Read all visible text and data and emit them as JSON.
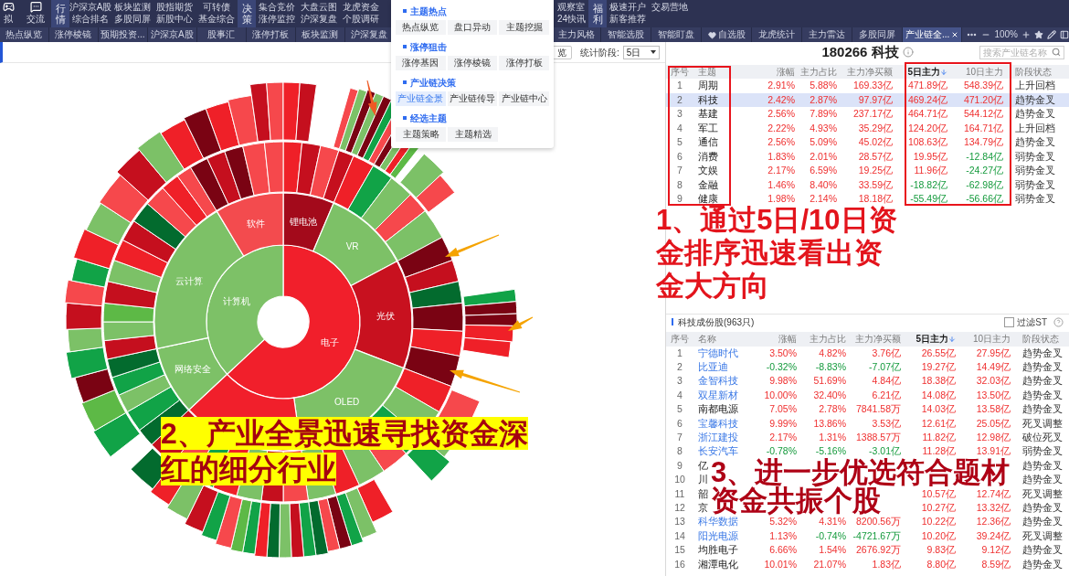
{
  "top_bar": {
    "shortcuts": [
      {
        "label": "拟"
      },
      {
        "label": "交流"
      }
    ],
    "groups": [
      {
        "title": "行情",
        "columns": [
          [
            "沪深京A股",
            "综合排名"
          ],
          [
            "板块监测",
            "多股同屏"
          ],
          [
            "股指期货",
            "新股中心"
          ],
          [
            "可转债",
            "基金综合"
          ]
        ]
      },
      {
        "title": "决策",
        "columns": [
          [
            "集合竞价",
            "涨停监控"
          ],
          [
            "大盘云图",
            "沪深复盘"
          ],
          [
            "龙虎资金",
            "个股调研"
          ],
          [
            "观察室",
            "24快讯"
          ]
        ]
      },
      {
        "title": "福利",
        "columns": [
          [
            "极速开户",
            "新客推荐"
          ],
          [
            "交易营地"
          ]
        ]
      }
    ]
  },
  "tab_bar": {
    "tabs": [
      {
        "label": "热点纵览",
        "selected": false,
        "kind": "text"
      },
      {
        "label": "涨停棱镜",
        "selected": false,
        "kind": "text"
      },
      {
        "label": "预期投资...",
        "selected": false,
        "kind": "text"
      },
      {
        "label": "沪深京A股",
        "selected": false,
        "kind": "text"
      },
      {
        "label": "股事汇",
        "selected": false,
        "kind": "text"
      },
      {
        "label": "涨停打板",
        "selected": false,
        "kind": "text"
      },
      {
        "label": "板块监测",
        "selected": false,
        "kind": "text"
      },
      {
        "label": "沪深复盘",
        "selected": false,
        "kind": "text"
      },
      {
        "label": "主力风格",
        "selected": false,
        "kind": "text"
      },
      {
        "label": "智能选股",
        "selected": false,
        "kind": "text"
      },
      {
        "label": "智能盯盘",
        "selected": false,
        "kind": "text"
      },
      {
        "label": "自选股",
        "selected": false,
        "kind": "icon_text"
      },
      {
        "label": "龙虎统计",
        "selected": false,
        "kind": "text"
      },
      {
        "label": "主力雷达",
        "selected": false,
        "kind": "text"
      },
      {
        "label": "多股同屏",
        "selected": false,
        "kind": "text"
      },
      {
        "label": "产业链全...",
        "selected": true,
        "kind": "text"
      }
    ],
    "zoom_level": "100%"
  },
  "dropdown_menu": {
    "sections": [
      {
        "title": "主题热点",
        "items": [
          {
            "label": "热点纵览",
            "selected": false
          },
          {
            "label": "盘口异动",
            "selected": false
          },
          {
            "label": "主题挖掘",
            "selected": false
          }
        ]
      },
      {
        "title": "涨停狙击",
        "items": [
          {
            "label": "涨停基因",
            "selected": false
          },
          {
            "label": "涨停棱镜",
            "selected": false
          },
          {
            "label": "涨停打板",
            "selected": false
          }
        ]
      },
      {
        "title": "产业链决策",
        "items": [
          {
            "label": "产业链全景",
            "selected": true
          },
          {
            "label": "产业链传导",
            "selected": false
          },
          {
            "label": "产业链中心",
            "selected": false
          }
        ]
      },
      {
        "title": "经选主题",
        "items": [
          {
            "label": "主题策略",
            "selected": false
          },
          {
            "label": "主题精选",
            "selected": false
          }
        ]
      }
    ]
  },
  "toolbar": {
    "overview_button": "览",
    "period_label": "统计阶段:",
    "period_value": "5日"
  },
  "industry_chart": {
    "inner_ring": [
      {
        "label": "电子",
        "color": "#f11f2b"
      },
      {
        "label": "计算机",
        "color": "#7dc167"
      }
    ],
    "middle_ring": [
      {
        "label": "锂电池",
        "color": "#a30a1b"
      },
      {
        "label": "VR",
        "color": "#7dc167"
      },
      {
        "label": "光伏",
        "color": "#c8111f"
      },
      {
        "label": "OLED",
        "color": "#7dc167"
      },
      {
        "color": "#f11f2b"
      },
      {
        "label": "网络安全",
        "color": "#7dc167"
      },
      {
        "label": "云计算",
        "color": "#7dc167"
      },
      {
        "label": "软件",
        "color": "#f34b4e"
      }
    ]
  },
  "theme_panel": {
    "title": "180266 科技",
    "search_placeholder": "搜索产业链名称",
    "columns": [
      {
        "label": "序号",
        "sorted": false
      },
      {
        "label": "主题",
        "sorted": false
      },
      {
        "label": "涨幅",
        "sorted": false
      },
      {
        "label": "主力占比",
        "sorted": false
      },
      {
        "label": "主力净买额",
        "sorted": false
      },
      {
        "label": "5日主力",
        "sorted": true
      },
      {
        "label": "10日主力",
        "sorted": false
      },
      {
        "label": "阶段状态",
        "sorted": false
      }
    ],
    "rows": [
      {
        "no": "1",
        "name": "周期",
        "selected": false,
        "change": {
          "text": "2.91%",
          "negative": false
        },
        "main_ratio": {
          "text": "5.88%",
          "negative": false
        },
        "net_buy": {
          "text": "169.33亿",
          "negative": false
        },
        "main_5d": {
          "text": "471.89亿",
          "negative": false
        },
        "main_10d": {
          "text": "548.39亿",
          "negative": false
        },
        "stage": "上升回档"
      },
      {
        "no": "2",
        "name": "科技",
        "selected": true,
        "change": {
          "text": "2.42%",
          "negative": false
        },
        "main_ratio": {
          "text": "2.87%",
          "negative": false
        },
        "net_buy": {
          "text": "97.97亿",
          "negative": false
        },
        "main_5d": {
          "text": "469.24亿",
          "negative": false
        },
        "main_10d": {
          "text": "471.20亿",
          "negative": false
        },
        "stage": "趋势金叉"
      },
      {
        "no": "3",
        "name": "基建",
        "selected": false,
        "change": {
          "text": "2.56%",
          "negative": false
        },
        "main_ratio": {
          "text": "7.89%",
          "negative": false
        },
        "net_buy": {
          "text": "237.17亿",
          "negative": false
        },
        "main_5d": {
          "text": "464.71亿",
          "negative": false
        },
        "main_10d": {
          "text": "544.12亿",
          "negative": false
        },
        "stage": "趋势金叉"
      },
      {
        "no": "4",
        "name": "军工",
        "selected": false,
        "change": {
          "text": "2.22%",
          "negative": false
        },
        "main_ratio": {
          "text": "4.93%",
          "negative": false
        },
        "net_buy": {
          "text": "35.29亿",
          "negative": false
        },
        "main_5d": {
          "text": "124.20亿",
          "negative": false
        },
        "main_10d": {
          "text": "164.71亿",
          "negative": false
        },
        "stage": "上升回档"
      },
      {
        "no": "5",
        "name": "通信",
        "selected": false,
        "change": {
          "text": "2.56%",
          "negative": false
        },
        "main_ratio": {
          "text": "5.09%",
          "negative": false
        },
        "net_buy": {
          "text": "45.02亿",
          "negative": false
        },
        "main_5d": {
          "text": "108.63亿",
          "negative": false
        },
        "main_10d": {
          "text": "134.79亿",
          "negative": false
        },
        "stage": "趋势金叉"
      },
      {
        "no": "6",
        "name": "消费",
        "selected": false,
        "change": {
          "text": "1.83%",
          "negative": false
        },
        "main_ratio": {
          "text": "2.01%",
          "negative": false
        },
        "net_buy": {
          "text": "28.57亿",
          "negative": false
        },
        "main_5d": {
          "text": "19.95亿",
          "negative": false
        },
        "main_10d": {
          "text": "-12.84亿",
          "negative": true
        },
        "stage": "弱势金叉"
      },
      {
        "no": "7",
        "name": "文娱",
        "selected": false,
        "change": {
          "text": "2.17%",
          "negative": false
        },
        "main_ratio": {
          "text": "6.59%",
          "negative": false
        },
        "net_buy": {
          "text": "19.25亿",
          "negative": false
        },
        "main_5d": {
          "text": "11.96亿",
          "negative": false
        },
        "main_10d": {
          "text": "-24.27亿",
          "negative": true
        },
        "stage": "弱势金叉"
      },
      {
        "no": "8",
        "name": "金融",
        "selected": false,
        "change": {
          "text": "1.46%",
          "negative": false
        },
        "main_ratio": {
          "text": "8.40%",
          "negative": false
        },
        "net_buy": {
          "text": "33.59亿",
          "negative": false
        },
        "main_5d": {
          "text": "-18.82亿",
          "negative": true
        },
        "main_10d": {
          "text": "-62.98亿",
          "negative": true
        },
        "stage": "弱势金叉"
      },
      {
        "no": "9",
        "name": "健康",
        "selected": false,
        "change": {
          "text": "1.98%",
          "negative": false
        },
        "main_ratio": {
          "text": "2.14%",
          "negative": false
        },
        "net_buy": {
          "text": "18.18亿",
          "negative": false
        },
        "main_5d": {
          "text": "-55.49亿",
          "negative": true
        },
        "main_10d": {
          "text": "-56.66亿",
          "negative": true
        },
        "stage": "弱势金叉"
      }
    ]
  },
  "stock_panel": {
    "title": "科技成份股(963只)",
    "filter": {
      "label": "过滤ST",
      "checked": false
    },
    "columns": [
      {
        "label": "序号",
        "sorted": false
      },
      {
        "label": "名称",
        "sorted": false
      },
      {
        "label": "涨幅",
        "sorted": false
      },
      {
        "label": "主力占比",
        "sorted": false
      },
      {
        "label": "主力净买额",
        "sorted": false
      },
      {
        "label": "5日主力",
        "sorted": true
      },
      {
        "label": "10日主力",
        "sorted": false
      },
      {
        "label": "阶段状态",
        "sorted": false
      }
    ],
    "rows": [
      {
        "no": "1",
        "name": "宁德时代",
        "marked": true,
        "change": {
          "text": "3.50%",
          "negative": false
        },
        "main_ratio": {
          "text": "4.82%",
          "negative": false
        },
        "net_buy": {
          "text": "3.76亿",
          "negative": false
        },
        "main_5d": {
          "text": "26.55亿",
          "negative": false
        },
        "main_10d": {
          "text": "27.95亿",
          "negative": false
        },
        "stage": "趋势金叉"
      },
      {
        "no": "2",
        "name": "比亚迪",
        "marked": true,
        "change": {
          "text": "-0.32%",
          "negative": true
        },
        "main_ratio": {
          "text": "-8.83%",
          "negative": true
        },
        "net_buy": {
          "text": "-7.07亿",
          "negative": true
        },
        "main_5d": {
          "text": "19.27亿",
          "negative": false
        },
        "main_10d": {
          "text": "14.49亿",
          "negative": false
        },
        "stage": "趋势金叉"
      },
      {
        "no": "3",
        "name": "金智科技",
        "marked": true,
        "change": {
          "text": "9.98%",
          "negative": false
        },
        "main_ratio": {
          "text": "51.69%",
          "negative": false
        },
        "net_buy": {
          "text": "4.84亿",
          "negative": false
        },
        "main_5d": {
          "text": "18.38亿",
          "negative": false
        },
        "main_10d": {
          "text": "32.03亿",
          "negative": false
        },
        "stage": "趋势金叉"
      },
      {
        "no": "4",
        "name": "双星新材",
        "marked": true,
        "change": {
          "text": "10.00%",
          "negative": false
        },
        "main_ratio": {
          "text": "32.40%",
          "negative": false
        },
        "net_buy": {
          "text": "6.21亿",
          "negative": false
        },
        "main_5d": {
          "text": "14.08亿",
          "negative": false
        },
        "main_10d": {
          "text": "13.50亿",
          "negative": false
        },
        "stage": "趋势金叉"
      },
      {
        "no": "5",
        "name": "南都电源",
        "marked": false,
        "change": {
          "text": "7.05%",
          "negative": false
        },
        "main_ratio": {
          "text": "2.78%",
          "negative": false
        },
        "net_buy": {
          "text": "7841.58万",
          "negative": false
        },
        "main_5d": {
          "text": "14.03亿",
          "negative": false
        },
        "main_10d": {
          "text": "13.58亿",
          "negative": false
        },
        "stage": "趋势金叉"
      },
      {
        "no": "6",
        "name": "宝馨科技",
        "marked": true,
        "change": {
          "text": "9.99%",
          "negative": false
        },
        "main_ratio": {
          "text": "13.86%",
          "negative": false
        },
        "net_buy": {
          "text": "3.53亿",
          "negative": false
        },
        "main_5d": {
          "text": "12.61亿",
          "negative": false
        },
        "main_10d": {
          "text": "25.05亿",
          "negative": false
        },
        "stage": "死叉调整"
      },
      {
        "no": "7",
        "name": "浙江建投",
        "marked": true,
        "change": {
          "text": "2.17%",
          "negative": false
        },
        "main_ratio": {
          "text": "1.31%",
          "negative": false
        },
        "net_buy": {
          "text": "1388.57万",
          "negative": false
        },
        "main_5d": {
          "text": "11.82亿",
          "negative": false
        },
        "main_10d": {
          "text": "12.98亿",
          "negative": false
        },
        "stage": "破位死叉"
      },
      {
        "no": "8",
        "name": "长安汽车",
        "marked": true,
        "change": {
          "text": "-0.78%",
          "negative": true
        },
        "main_ratio": {
          "text": "-5.16%",
          "negative": true
        },
        "net_buy": {
          "text": "-3.01亿",
          "negative": true
        },
        "main_5d": {
          "text": "11.28亿",
          "negative": false
        },
        "main_10d": {
          "text": "13.91亿",
          "negative": false
        },
        "stage": "弱势金叉"
      },
      {
        "no": "9",
        "name": "亿",
        "marked": false,
        "stage": "趋势金叉"
      },
      {
        "no": "10",
        "name": "川",
        "marked": false,
        "stage": "趋势金叉"
      },
      {
        "no": "11",
        "name": "韶",
        "marked": false,
        "main_5d": {
          "text": "10.57亿",
          "negative": false
        },
        "main_10d": {
          "text": "12.74亿",
          "negative": false
        },
        "stage": "死叉调整"
      },
      {
        "no": "12",
        "name": "京",
        "marked": false,
        "main_5d": {
          "text": "10.27亿",
          "negative": false
        },
        "main_10d": {
          "text": "13.32亿",
          "negative": false
        },
        "stage": "趋势金叉"
      },
      {
        "no": "13",
        "name": "科华数据",
        "marked": true,
        "change": {
          "text": "5.32%",
          "negative": false
        },
        "main_ratio": {
          "text": "4.31%",
          "negative": false
        },
        "net_buy": {
          "text": "8200.56万",
          "negative": false
        },
        "main_5d": {
          "text": "10.22亿",
          "negative": false
        },
        "main_10d": {
          "text": "12.36亿",
          "negative": false
        },
        "stage": "趋势金叉"
      },
      {
        "no": "14",
        "name": "阳光电源",
        "marked": true,
        "change": {
          "text": "1.13%",
          "negative": false
        },
        "main_ratio": {
          "text": "-0.74%",
          "negative": true
        },
        "net_buy": {
          "text": "-4721.67万",
          "negative": true
        },
        "main_5d": {
          "text": "10.20亿",
          "negative": false
        },
        "main_10d": {
          "text": "39.24亿",
          "negative": false
        },
        "stage": "死叉调整"
      },
      {
        "no": "15",
        "name": "均胜电子",
        "marked": false,
        "change": {
          "text": "6.66%",
          "negative": false
        },
        "main_ratio": {
          "text": "1.54%",
          "negative": false
        },
        "net_buy": {
          "text": "2676.92万",
          "negative": false
        },
        "main_5d": {
          "text": "9.83亿",
          "negative": false
        },
        "main_10d": {
          "text": "9.12亿",
          "negative": false
        },
        "stage": "趋势金叉"
      },
      {
        "no": "16",
        "name": "湘潭电化",
        "marked": false,
        "change": {
          "text": "10.01%",
          "negative": false
        },
        "main_ratio": {
          "text": "21.07%",
          "negative": false
        },
        "net_buy": {
          "text": "1.83亿",
          "negative": false
        },
        "main_5d": {
          "text": "8.80亿",
          "negative": false
        },
        "main_10d": {
          "text": "8.59亿",
          "negative": false
        },
        "stage": "趋势金叉"
      }
    ]
  },
  "annotations": [
    {
      "text": "1、通过5日/10日资金排序迅速看出资金大方向",
      "highlighted": false
    },
    {
      "text": "2、产业全景迅速寻找资金深红的细分行业",
      "highlighted": true
    },
    {
      "text": "3、进一步优选符合题材",
      "highlighted": false
    },
    {
      "text": "资金共振个股",
      "highlighted": false
    }
  ]
}
